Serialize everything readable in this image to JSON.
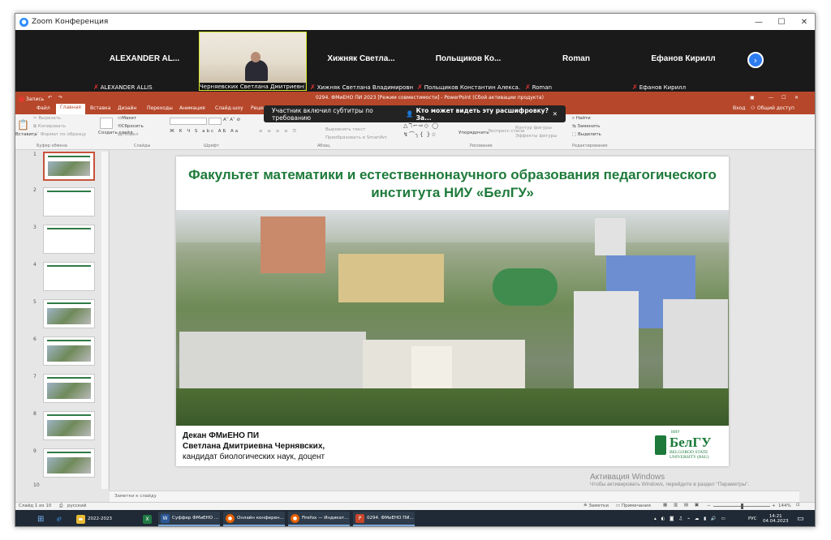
{
  "zoom": {
    "window_title": "Zoom Конференция",
    "participants": [
      {
        "name": "ALEXANDER AL...",
        "label": "ALEXANDER ALLIS"
      },
      {
        "name": "",
        "label": "Черняевских Светлана Дмитриевна"
      },
      {
        "name": "Хижняк  Светла...",
        "label": "Хижняк Светлана Владимировна"
      },
      {
        "name": "Польщиков  Ко...",
        "label": "Польщиков Константин Алекса..."
      },
      {
        "name": "Roman",
        "label": "Roman"
      },
      {
        "name": "Ефанов Кирилл",
        "label": "Ефанов Кирилл"
      }
    ],
    "recording_label": "Запись",
    "caption_text": "Участник включил субтитры по требованию",
    "caption_question": "Кто может видеть эту расшифровку? За...",
    "next_icon": "chevron-right-icon"
  },
  "powerpoint": {
    "title": "0294. ФМиЕНО ПИ 2023 [Режим совместимости] - PowerPoint (Сбой активации продукта)",
    "tabs": [
      "Файл",
      "Главная",
      "Вставка",
      "Дизайн",
      "Переходы",
      "Анимация",
      "Слайд-шоу",
      "Рецен"
    ],
    "sign_in": "Вход",
    "share": "Общий доступ",
    "ribbon": {
      "paste": "Вставить",
      "cut": "Вырезать",
      "copy": "Копировать",
      "format_painter": "Формат по образцу",
      "clipboard_group": "Буфер обмена",
      "new_slide": "Создать слайд",
      "layout": "Макет",
      "reset": "Сбросить",
      "section": "Раздел",
      "slides_group": "Слайды",
      "font_group": "Шрифт",
      "paragraph_group": "Абзац",
      "align_text": "Выровнять текст",
      "smartart": "Преобразовать в SmartArt",
      "arrange": "Упорядочить",
      "quick_styles": "Экспресс-стили",
      "shape_outline": "Контур фигуры",
      "shape_effects": "Эффекты фигуры",
      "drawing_group": "Рисование",
      "find": "Найти",
      "replace": "Заменить",
      "select": "Выделить",
      "editing_group": "Редактирование"
    },
    "slide_numbers": [
      "1",
      "2",
      "3",
      "4",
      "5",
      "6",
      "7",
      "8",
      "9",
      "10"
    ],
    "slide": {
      "title": "Факультет математики и естественнонаучного образования педагогического института НИУ «БелГУ»",
      "dean_line1": "Декан ФМиЕНО ПИ",
      "dean_line2": "Светлана Дмитриевна Чернявских,",
      "dean_line3": "кандидат биологических наук, доцент",
      "logo_top": "НИУ",
      "logo_main": "БелГУ",
      "logo_sub1": "BELGOROD STATE",
      "logo_sub2": "UNIVERSITY (BSU)"
    },
    "notes_placeholder": "Заметки к слайду",
    "status_slide": "Слайд 1 из 10",
    "status_lang": "русский",
    "status_notes": "Заметки",
    "status_comments": "Примечания",
    "zoom_level": "144%"
  },
  "watermark": {
    "line1": "Активация Windows",
    "line2": "Чтобы активировать Windows, перейдите в раздел \"Параметры\"."
  },
  "taskbar": {
    "items": [
      {
        "label": "2022-2023",
        "icon": "folder-icon"
      },
      {
        "label": "Суффер ФМиЕНО ...",
        "icon": "word-icon"
      },
      {
        "label": "Онлайн конферен...",
        "icon": "firefox-icon"
      },
      {
        "label": "Firefox — Индикат...",
        "icon": "firefox-icon"
      },
      {
        "label": "0294. ФМиЕНО ПИ...",
        "icon": "powerpoint-icon"
      }
    ],
    "lang": "РУС",
    "time": "14:21",
    "date": "04.04.2023"
  }
}
